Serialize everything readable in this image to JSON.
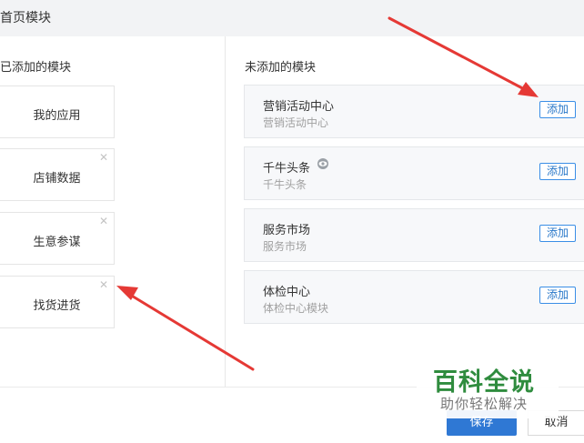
{
  "header": {
    "title": "首页模块"
  },
  "left": {
    "title": "已添加的模块",
    "items": [
      {
        "label": "我的应用",
        "closable": false
      },
      {
        "label": "店铺数据",
        "closable": true
      },
      {
        "label": "生意参谋",
        "closable": true
      },
      {
        "label": "找货进货",
        "closable": true
      }
    ]
  },
  "right": {
    "title": "未添加的模块",
    "items": [
      {
        "name": "营销活动中心",
        "desc": "营销活动中心",
        "add_label": "添加"
      },
      {
        "name": "千牛头条",
        "desc": "千牛头条",
        "add_label": "添加",
        "icon": "eye-icon"
      },
      {
        "name": "服务市场",
        "desc": "服务市场",
        "add_label": "添加"
      },
      {
        "name": "体检中心",
        "desc": "体检中心模块",
        "add_label": "添加"
      }
    ]
  },
  "footer": {
    "save_label": "保存",
    "cancel_label": "取消"
  },
  "watermark": {
    "title": "百科全说",
    "subtitle": "助你轻松解决"
  },
  "colors": {
    "primary": "#2f78d4",
    "arrow": "#e53935",
    "watermark": "#2f8c3e"
  }
}
